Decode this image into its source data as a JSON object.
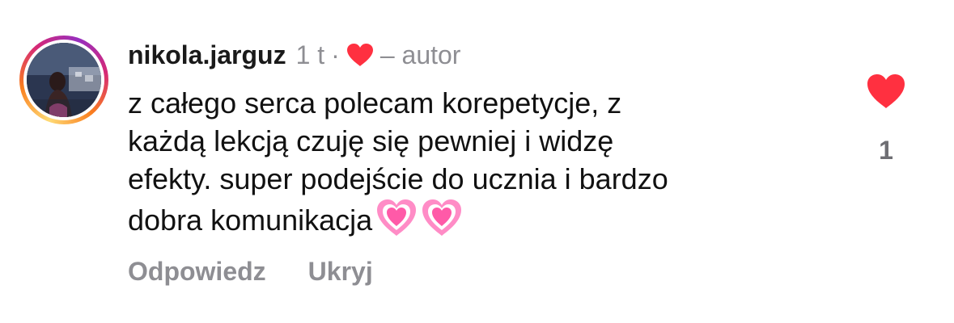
{
  "comment": {
    "username": "nikola.jarguz",
    "time": "1 t",
    "separator": "·",
    "author_label": "– autor",
    "body_lines": [
      "z całego serca polecam korepetycje, z",
      "każdą lekcją czuję się pewniej i widzę",
      "efekty. super podejście do ucznia i bardzo",
      "dobra komunikacja"
    ],
    "body_emoji": [
      "growing-heart-emoji",
      "growing-heart-emoji"
    ],
    "like_count": "1"
  },
  "actions": {
    "reply_label": "Odpowiedz",
    "hide_label": "Ukryj"
  },
  "icons": {
    "liked_by_author": "heart-icon",
    "like_button": "heart-icon"
  },
  "colors": {
    "heart": "#ff3040",
    "muted_text": "#8e8e93",
    "emoji_pink": "#ff6fb5"
  }
}
